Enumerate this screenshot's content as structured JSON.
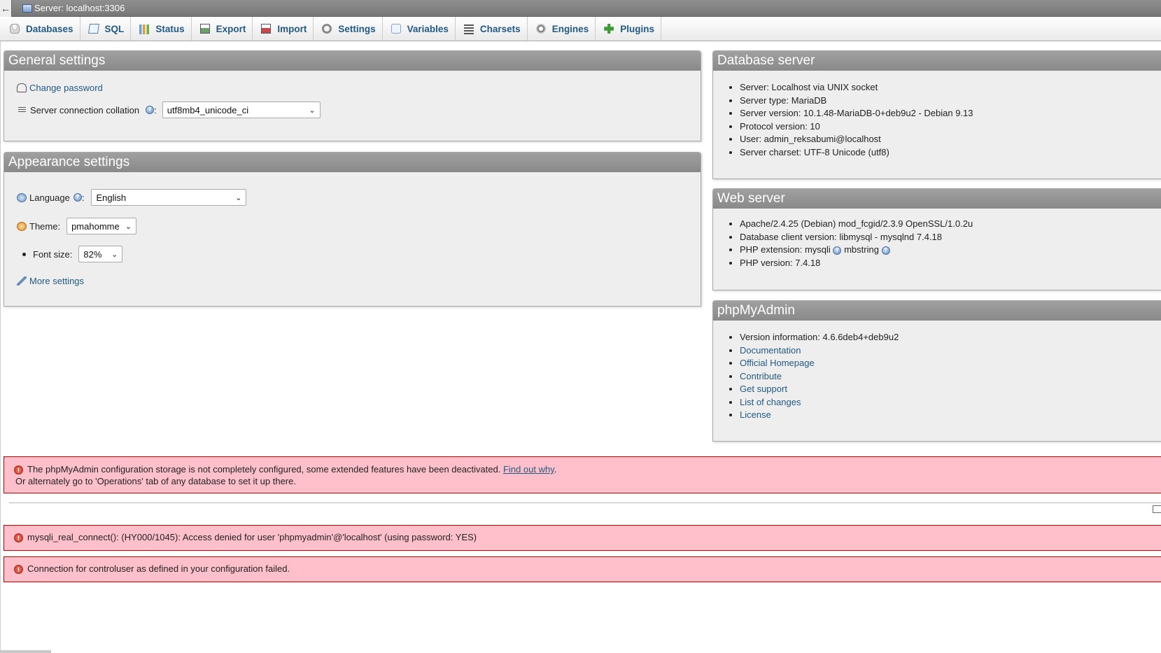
{
  "breadcrumb": {
    "back_label": "←",
    "server": "Server: localhost:3306"
  },
  "tabs": [
    {
      "label": "Databases",
      "icon": "database-icon"
    },
    {
      "label": "SQL",
      "icon": "sql-icon"
    },
    {
      "label": "Status",
      "icon": "status-icon"
    },
    {
      "label": "Export",
      "icon": "export-icon"
    },
    {
      "label": "Import",
      "icon": "import-icon"
    },
    {
      "label": "Settings",
      "icon": "settings-icon"
    },
    {
      "label": "Variables",
      "icon": "variables-icon"
    },
    {
      "label": "Charsets",
      "icon": "charsets-icon"
    },
    {
      "label": "Engines",
      "icon": "engines-icon"
    },
    {
      "label": "Plugins",
      "icon": "plugins-icon"
    }
  ],
  "general": {
    "title": "General settings",
    "change_password": "Change password",
    "collation_label": "Server connection collation",
    "collation_value": "utf8mb4_unicode_ci"
  },
  "appearance": {
    "title": "Appearance settings",
    "language_label": "Language",
    "language_value": "English",
    "theme_label": "Theme:",
    "theme_value": "pmahomme",
    "font_label": "Font size:",
    "font_value": "82%",
    "more_settings": "More settings"
  },
  "db_server": {
    "title": "Database server",
    "items": [
      "Server: Localhost via UNIX socket",
      "Server type: MariaDB",
      "Server version: 10.1.48-MariaDB-0+deb9u2 - Debian 9.13",
      "Protocol version: 10",
      "User: admin_reksabumi@localhost",
      "Server charset: UTF-8 Unicode (utf8)"
    ]
  },
  "web_server": {
    "title": "Web server",
    "items": [
      "Apache/2.4.25 (Debian) mod_fcgid/2.3.9 OpenSSL/1.0.2u",
      "Database client version: libmysql - mysqlnd 7.4.18",
      "PHP extension: mysqli",
      "mbstring",
      "PHP version: 7.4.18"
    ]
  },
  "pma": {
    "title": "phpMyAdmin",
    "version": "Version information: 4.6.6deb4+deb9u2",
    "links": [
      "Documentation",
      "Official Homepage",
      "Contribute",
      "Get support",
      "List of changes",
      "License"
    ]
  },
  "errors": {
    "config_msg": "The phpMyAdmin configuration storage is not completely configured, some extended features have been deactivated.",
    "config_link": "Find out why",
    "config_msg2": "Or alternately go to 'Operations' tab of any database to set it up there.",
    "mysqli": "mysqli_real_connect(): (HY000/1045): Access denied for user 'phpmyadmin'@'localhost' (using password: YES)",
    "controluser": "Connection for controluser as defined in your configuration failed."
  },
  "colors": {
    "link": "#235a81",
    "error_bg": "#ffc0cb",
    "error_border": "#cc0000"
  }
}
